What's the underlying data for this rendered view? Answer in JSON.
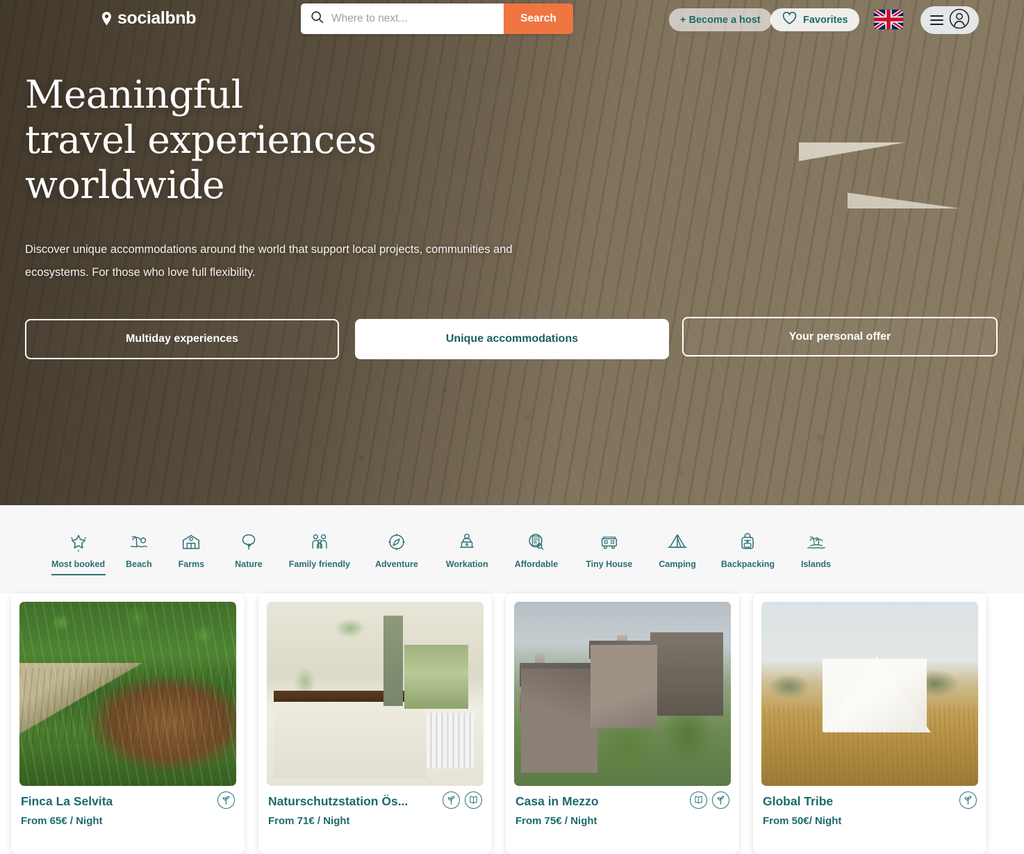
{
  "brand": {
    "name": "socialbnb",
    "icon": "location-pin-icon"
  },
  "search": {
    "placeholder": "Where to next...",
    "value": "",
    "button_label": "Search",
    "icon": "search-icon",
    "accent_color": "#ef7541"
  },
  "header": {
    "become_host_label": "+ Become a host",
    "favorites_label": "Favorites",
    "favorites_icon": "heart-icon",
    "language_flag": "uk-flag-icon",
    "menu_icon": "hamburger-icon",
    "account_icon": "user-avatar-icon",
    "teal_color": "#1c6a6d"
  },
  "hero": {
    "title_line1": "Meaningful",
    "title_line2": "travel experiences",
    "title_line3": "worldwide",
    "subtitle_line1": "Discover unique accommodations around the world that support local projects, communities and",
    "subtitle_line2": "ecosystems. For those who love full flexibility.",
    "ctas": [
      {
        "label": "Multiday experiences",
        "style": "outline"
      },
      {
        "label": "Unique accommodations",
        "style": "filled"
      },
      {
        "label": "Your personal offer",
        "style": "outline"
      }
    ]
  },
  "categories": [
    {
      "label": "Most booked",
      "icon": "star-icon",
      "active": true
    },
    {
      "label": "Beach",
      "icon": "palm-beach-icon",
      "active": false
    },
    {
      "label": "Farms",
      "icon": "barn-icon",
      "active": false
    },
    {
      "label": "Nature",
      "icon": "tree-icon",
      "active": false
    },
    {
      "label": "Family friendly",
      "icon": "family-icon",
      "active": false
    },
    {
      "label": "Adventure",
      "icon": "compass-icon",
      "active": false
    },
    {
      "label": "Workation",
      "icon": "laptop-person-icon",
      "active": false
    },
    {
      "label": "Affordable",
      "icon": "price-tag-icon",
      "active": false
    },
    {
      "label": "Tiny House",
      "icon": "tiny-house-icon",
      "active": false
    },
    {
      "label": "Camping",
      "icon": "tent-icon",
      "active": false
    },
    {
      "label": "Backpacking",
      "icon": "backpack-icon",
      "active": false
    },
    {
      "label": "Islands",
      "icon": "island-palm-icon",
      "active": false
    }
  ],
  "listings": [
    {
      "title": "Finca La Selvita",
      "price": "From 65€ / Night",
      "photo": "jungle-thatched-cabin-photo",
      "badges": [
        "eco-leaf-icon"
      ]
    },
    {
      "title": "Naturschutzstation Ös...",
      "price": "From 71€ / Night",
      "photo": "country-kitchen-photo",
      "badges": [
        "eco-leaf-icon",
        "education-book-icon"
      ]
    },
    {
      "title": "Casa in Mezzo",
      "price": "From 75€ / Night",
      "photo": "alpine-stone-village-photo",
      "badges": [
        "education-book-icon",
        "eco-leaf-icon"
      ]
    },
    {
      "title": "Global Tribe",
      "price": "From 50€/ Night",
      "photo": "bell-tent-field-photo",
      "badges": [
        "eco-leaf-icon"
      ]
    }
  ]
}
